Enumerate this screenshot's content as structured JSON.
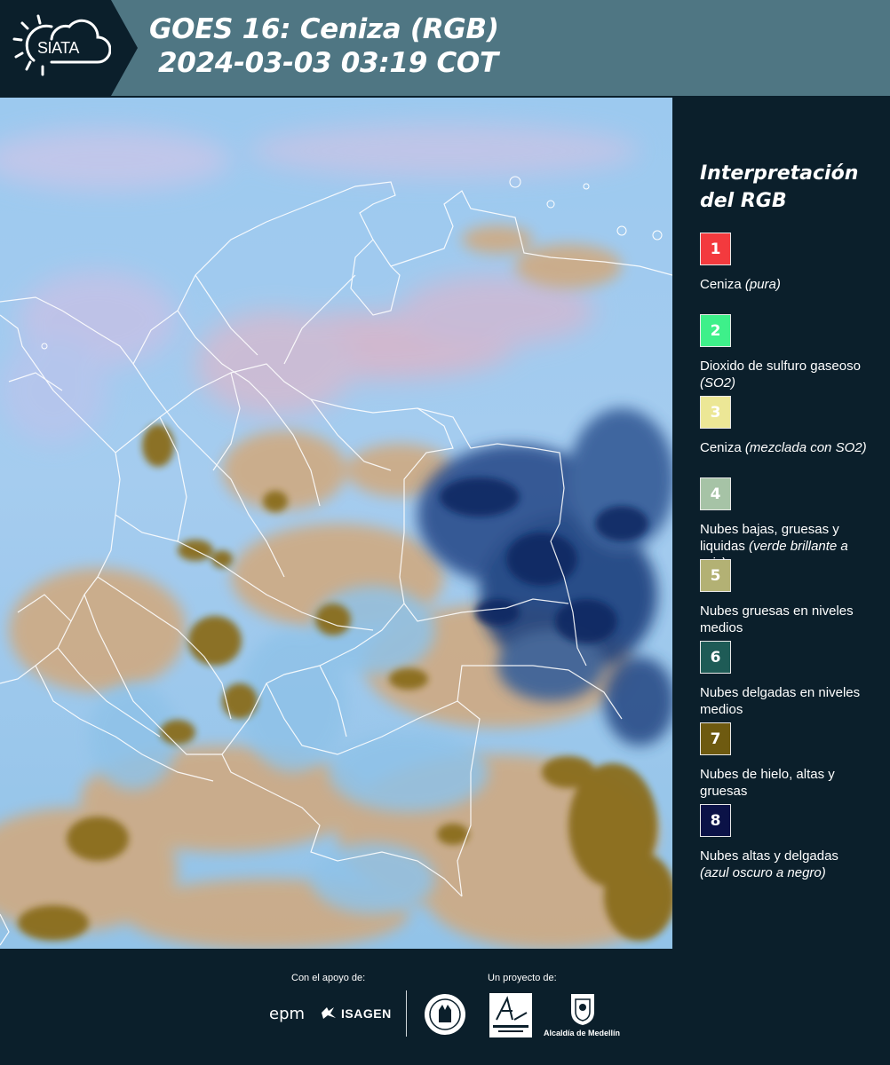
{
  "header": {
    "logo_text": "SIATA",
    "title_line1": "GOES 16: Ceniza (RGB)",
    "title_line2": "2024-03-03 03:19 COT"
  },
  "legend": {
    "title_line1": "Interpretación",
    "title_line2": "del RGB",
    "items": [
      {
        "num": "1",
        "color": "#f33a3e",
        "text_color": "#ffffff",
        "label": "Ceniza ",
        "note": "(pura)"
      },
      {
        "num": "2",
        "color": "#3ef08a",
        "text_color": "#ffffff",
        "label": "Dioxido de sulfuro gaseoso ",
        "note": "(SO2)"
      },
      {
        "num": "3",
        "color": "#ece796",
        "text_color": "#ffffff",
        "label": "Ceniza ",
        "note": "(mezclada con SO2)"
      },
      {
        "num": "4",
        "color": "#a6c3a6",
        "text_color": "#ffffff",
        "label": "Nubes bajas, gruesas y liquidas ",
        "note": "(verde brillante a gris)"
      },
      {
        "num": "5",
        "color": "#b3b174",
        "text_color": "#ffffff",
        "label": "Nubes gruesas en niveles medios",
        "note": ""
      },
      {
        "num": "6",
        "color": "#1e5b56",
        "text_color": "#ffffff",
        "label": "Nubes delgadas en niveles medios",
        "note": ""
      },
      {
        "num": "7",
        "color": "#6e5a10",
        "text_color": "#ffffff",
        "label": "Nubes de hielo, altas y gruesas",
        "note": ""
      },
      {
        "num": "8",
        "color": "#0b1247",
        "text_color": "#ffffff",
        "label": "Nubes altas y delgadas ",
        "note": "(azul oscuro a negro)"
      }
    ]
  },
  "footer": {
    "support_label": "Con el apoyo de:",
    "project_label": "Un proyecto de:",
    "epm": "epm",
    "isagen": "ISAGEN",
    "alcaldia": "Alcaldía de Medellín"
  }
}
